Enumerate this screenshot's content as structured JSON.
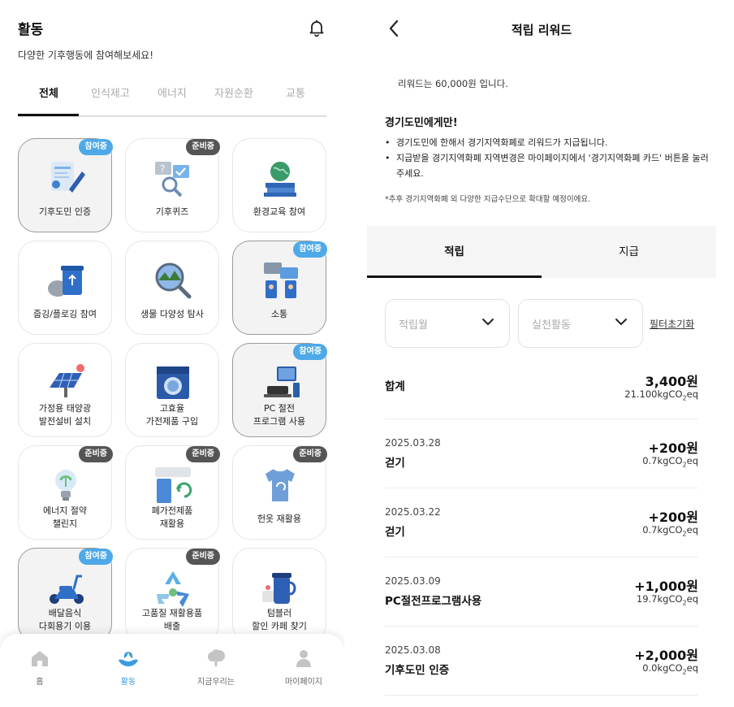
{
  "activity": {
    "title": "활동",
    "subtitle": "다양한 기후행동에 참여해보세요!",
    "tabs": [
      "전체",
      "인식제고",
      "에너지",
      "자원순환",
      "교통"
    ],
    "cards": [
      {
        "lines": [
          "기후도민 인증"
        ],
        "badge": "참여중",
        "badge_type": "join",
        "selected": true,
        "icon": "certificate-icon"
      },
      {
        "lines": [
          "기후퀴즈"
        ],
        "badge": "준비중",
        "badge_type": "prep",
        "selected": false,
        "icon": "quiz-icon"
      },
      {
        "lines": [
          "환경교육 참여"
        ],
        "badge": "",
        "badge_type": "",
        "selected": false,
        "icon": "globe-books-icon"
      },
      {
        "lines": [
          "줍깅/플로깅 참여"
        ],
        "badge": "",
        "badge_type": "",
        "selected": false,
        "icon": "recycle-bin-icon"
      },
      {
        "lines": [
          "생물 다양성 탐사"
        ],
        "badge": "",
        "badge_type": "",
        "selected": false,
        "icon": "magnifier-nature-icon"
      },
      {
        "lines": [
          "소통"
        ],
        "badge": "참여중",
        "badge_type": "join",
        "selected": true,
        "icon": "chat-phones-icon"
      },
      {
        "lines": [
          "가정용 태양광",
          "발전설비 설치"
        ],
        "badge": "",
        "badge_type": "",
        "selected": false,
        "icon": "solar-panel-icon"
      },
      {
        "lines": [
          "고효율",
          "가전제품 구입"
        ],
        "badge": "",
        "badge_type": "",
        "selected": false,
        "icon": "washing-machine-icon"
      },
      {
        "lines": [
          "PC 절전",
          "프로그램 사용"
        ],
        "badge": "참여중",
        "badge_type": "join",
        "selected": true,
        "icon": "pc-icon"
      },
      {
        "lines": [
          "에너지 절약",
          "챌린지"
        ],
        "badge": "준비중",
        "badge_type": "prep",
        "selected": false,
        "icon": "lightbulb-icon"
      },
      {
        "lines": [
          "폐가전제품",
          "재활용"
        ],
        "badge": "준비중",
        "badge_type": "prep",
        "selected": false,
        "icon": "appliance-recycle-icon"
      },
      {
        "lines": [
          "헌옷 재활용"
        ],
        "badge": "준비중",
        "badge_type": "prep",
        "selected": false,
        "icon": "tshirt-icon"
      },
      {
        "lines": [
          "배달음식",
          "다회용기 이용"
        ],
        "badge": "참여중",
        "badge_type": "join",
        "selected": true,
        "icon": "scooter-icon"
      },
      {
        "lines": [
          "고품질 재활용품",
          "배출"
        ],
        "badge": "준비중",
        "badge_type": "prep",
        "selected": false,
        "icon": "recycle-symbol-icon"
      },
      {
        "lines": [
          "텀블러",
          "할인 카페 찾기"
        ],
        "badge": "",
        "badge_type": "",
        "selected": false,
        "icon": "tumbler-icon"
      }
    ],
    "nav": [
      "홈",
      "활동",
      "지금우리는",
      "마이페이지"
    ]
  },
  "reward": {
    "title": "적립 리워드",
    "amount_note": "리워드는 60,000원 입니다.",
    "notice_title": "경기도민에게만!",
    "notice_items": [
      "경기도민에 한해서 경기지역화폐로 리워드가 지급됩니다.",
      "지급받을 경기지역화폐 지역변경은 마이페이지에서 '경기지역화폐 카드' 버튼을 눌러주세요."
    ],
    "notice_footnote": "*추후 경기지역화폐 외 다양한 지급수단으로 확대할 예정이에요.",
    "segments": [
      "적립",
      "지급"
    ],
    "filters": {
      "period_placeholder": "적립월",
      "activity_placeholder": "실천활동",
      "reset": "필터초기화"
    },
    "total": {
      "label": "합계",
      "points": "3,400원",
      "co2": "21.100kgCO",
      "co2_sub": "2",
      "co2_unit": "eq"
    },
    "entries": [
      {
        "date": "2025.03.28",
        "activity": "걷기",
        "points": "+200원",
        "co2": "0.7kgCO",
        "co2_sub": "2",
        "co2_unit": "eq"
      },
      {
        "date": "2025.03.22",
        "activity": "걷기",
        "points": "+200원",
        "co2": "0.7kgCO",
        "co2_sub": "2",
        "co2_unit": "eq"
      },
      {
        "date": "2025.03.09",
        "activity": "PC절전프로그램사용",
        "points": "+1,000원",
        "co2": "19.7kgCO",
        "co2_sub": "2",
        "co2_unit": "eq"
      },
      {
        "date": "2025.03.08",
        "activity": "기후도민 인증",
        "points": "+2,000원",
        "co2": "0.0kgCO",
        "co2_sub": "2",
        "co2_unit": "eq"
      }
    ]
  },
  "colors": {
    "accent": "#4ea9e8",
    "badge_prep": "#555555",
    "nav_active": "#3b9be0"
  }
}
